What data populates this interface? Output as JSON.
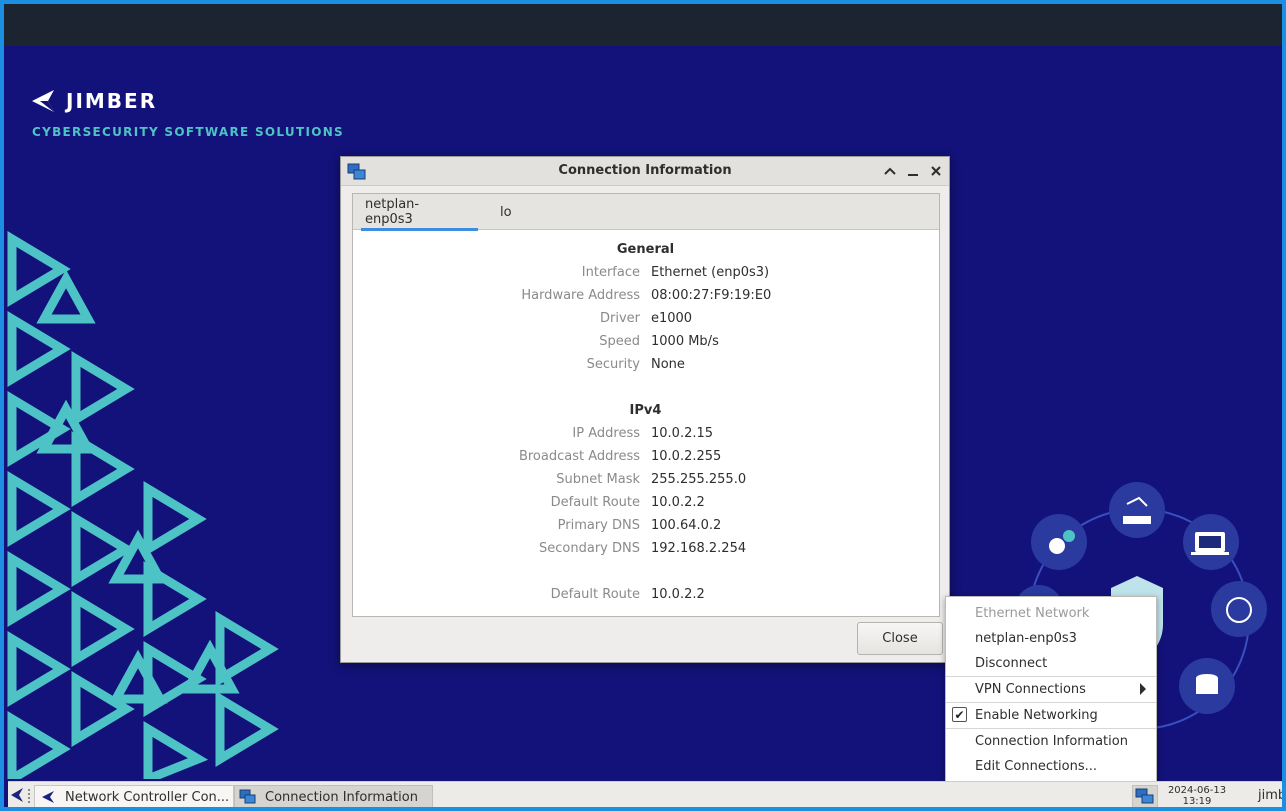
{
  "desktop": {
    "brand": "JIMBER",
    "tagline": "CYBERSECURITY SOFTWARE SOLUTIONS"
  },
  "dialog": {
    "title": "Connection Information",
    "tabs": [
      {
        "label": "netplan-enp0s3",
        "active": true
      },
      {
        "label": "lo",
        "active": false
      }
    ],
    "general": {
      "heading": "General",
      "rows": [
        {
          "label": "Interface",
          "value": "Ethernet (enp0s3)"
        },
        {
          "label": "Hardware Address",
          "value": "08:00:27:F9:19:E0"
        },
        {
          "label": "Driver",
          "value": "e1000"
        },
        {
          "label": "Speed",
          "value": "1000 Mb/s"
        },
        {
          "label": "Security",
          "value": "None"
        }
      ]
    },
    "ipv4": {
      "heading": "IPv4",
      "rows": [
        {
          "label": "IP Address",
          "value": "10.0.2.15"
        },
        {
          "label": "Broadcast Address",
          "value": "10.0.2.255"
        },
        {
          "label": "Subnet Mask",
          "value": "255.255.255.0"
        },
        {
          "label": "Default Route",
          "value": "10.0.2.2"
        },
        {
          "label": "Primary DNS",
          "value": "100.64.0.2"
        },
        {
          "label": "Secondary DNS",
          "value": "192.168.2.254"
        }
      ],
      "extra_row": {
        "label": "Default Route",
        "value": "10.0.2.2"
      }
    },
    "close_label": "Close"
  },
  "menu": {
    "header": "Ethernet Network",
    "connection": "netplan-enp0s3",
    "disconnect": "Disconnect",
    "vpn": "VPN Connections",
    "enable_networking": "Enable Networking",
    "enable_networking_checked": true,
    "connection_info": "Connection Information",
    "edit_connections": "Edit Connections..."
  },
  "taskbar": {
    "tasks": [
      {
        "label": "Network Controller Con..."
      },
      {
        "label": "Connection Information"
      }
    ],
    "date": "2024-06-13",
    "time": "13:19",
    "user": "jimber"
  },
  "colors": {
    "desktop_bg": "#12127a",
    "accent_teal": "#4ec3c6",
    "tab_underline": "#3d8de0"
  }
}
